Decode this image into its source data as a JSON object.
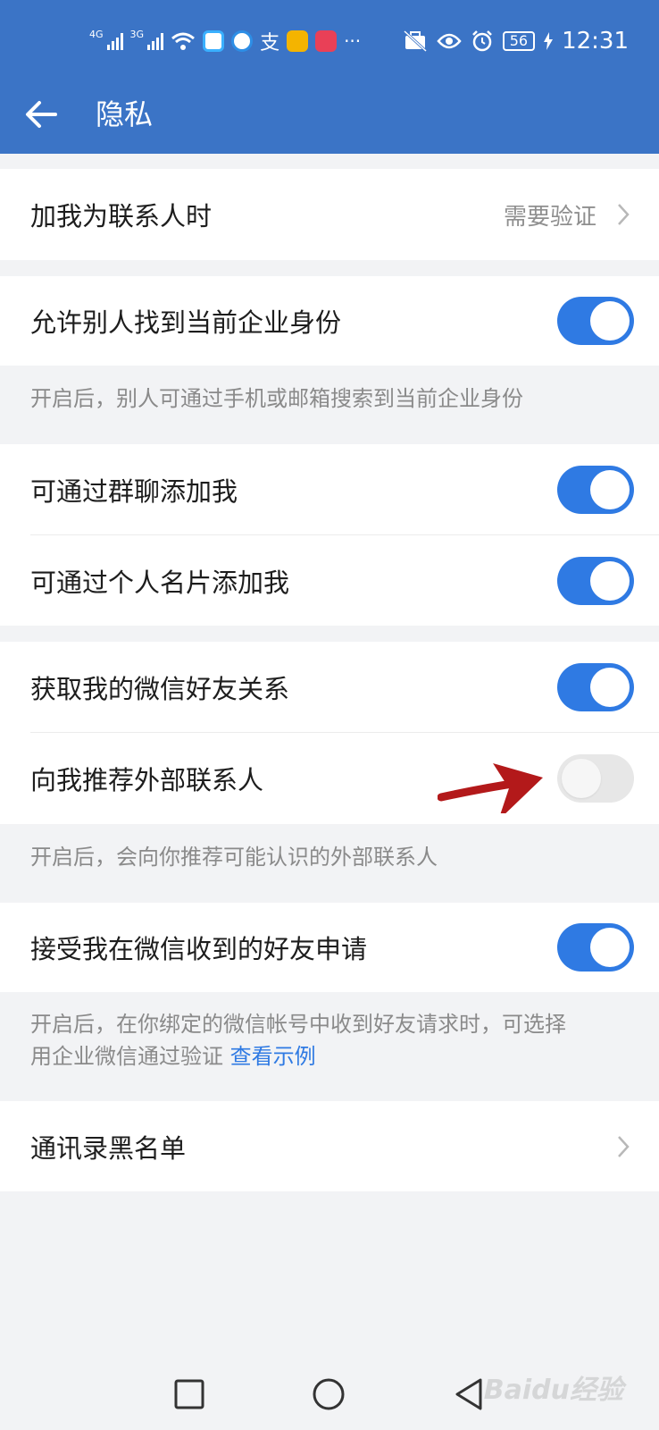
{
  "status_bar": {
    "signal_1": "4G",
    "signal_2": "3G",
    "battery": "56",
    "time": "12:31"
  },
  "header": {
    "back_icon": "arrow-left-icon",
    "title": "隐私"
  },
  "settings": {
    "add_contact": {
      "label": "加我为联系人时",
      "value": "需要验证"
    },
    "find_identity": {
      "label": "允许别人找到当前企业身份",
      "on": true
    },
    "find_identity_hint": "开启后，别人可通过手机或邮箱搜索到当前企业身份",
    "group_chat_add": {
      "label": "可通过群聊添加我",
      "on": true
    },
    "card_add": {
      "label": "可通过个人名片添加我",
      "on": true
    },
    "wechat_friends": {
      "label": "获取我的微信好友关系",
      "on": true
    },
    "recommend_external": {
      "label": "向我推荐外部联系人",
      "on": false
    },
    "recommend_hint": "开启后，会向你推荐可能认识的外部联系人",
    "accept_wechat_requests": {
      "label": "接受我在微信收到的好友申请",
      "on": true
    },
    "accept_hint_line1": "开启后，在你绑定的微信帐号中收到好友请求时，可选择",
    "accept_hint_line2": "用企业微信通过验证",
    "accept_hint_link": "查看示例",
    "blacklist": {
      "label": "通讯录黑名单"
    }
  },
  "watermark": "Baidu经验",
  "colors": {
    "header_bg": "#3b74c6",
    "toggle_on": "#2f7ae3",
    "toggle_off": "#e7e7e7",
    "annotation_arrow": "#b3191a"
  }
}
